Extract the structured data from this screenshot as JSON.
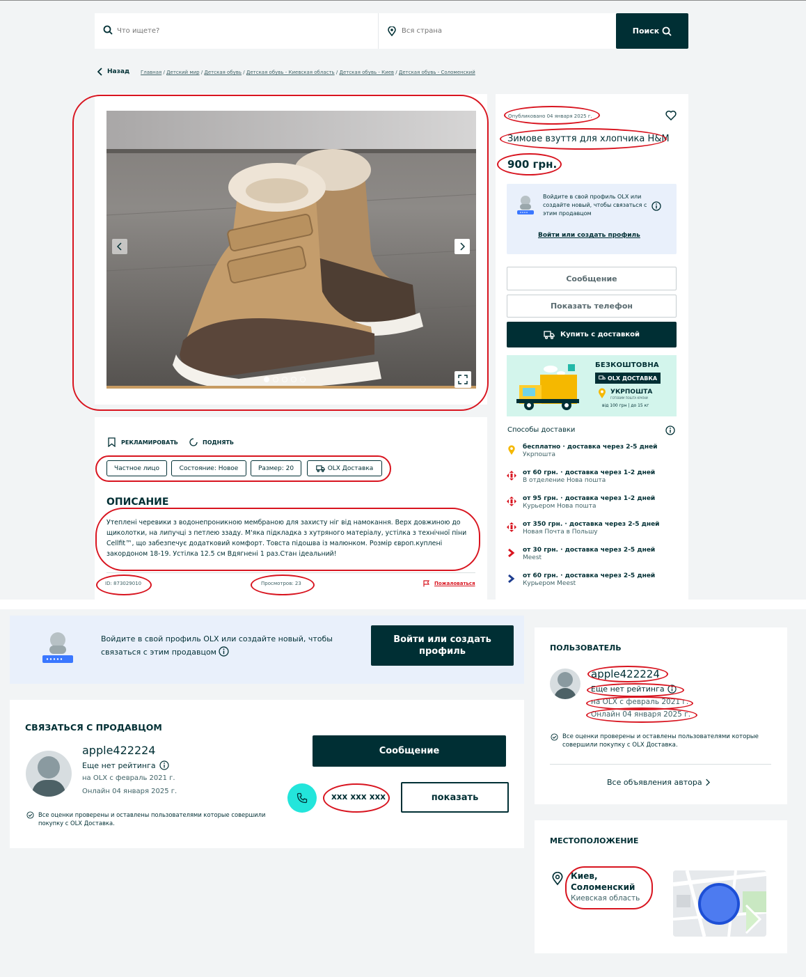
{
  "search": {
    "query_placeholder": "Что ищете?",
    "location_placeholder": "Вся страна",
    "button_label": "Поиск"
  },
  "nav": {
    "back_label": "Назад",
    "breadcrumbs": [
      "Главная",
      "Детский мир",
      "Детская обувь",
      "Детская обувь - Киевская область",
      "Детская обувь - Киев",
      "Детская обувь - Соломенский"
    ]
  },
  "gallery": {
    "slide_count": 5,
    "active_slide": 1
  },
  "listing": {
    "published": "Опубликовано 04 января 2025 г.",
    "title": "Зимове взуття для хлопчика H&M",
    "price": "900 грн."
  },
  "login_box_small": {
    "text": "Войдите в свой профиль OLX или создайте новый, чтобы связаться с этим продавцом",
    "link": "Войти или создать профиль"
  },
  "actions": {
    "message": "Сообщение",
    "show_phone": "Показать телефон",
    "buy": "Купить с доставкой"
  },
  "promo": {
    "headline": "БЕЗКОШТОВНА",
    "olx_delivery": "OLX ДОСТАВКА",
    "carrier": "УКРПОШТА",
    "carrier_sub": "ГОТОВИМ ПОШТА КРАЇНИ",
    "terms": "від 100 грн | до 15 кг"
  },
  "delivery": {
    "title": "Способы доставки",
    "options": [
      {
        "main": "бесплатно · доставка через 2-5 дней",
        "sub": "Укрпошта",
        "icon": "ukrposhta-pin-icon",
        "color": "#f5b800"
      },
      {
        "main": "от 60 грн. · доставка через 1-2 дней",
        "sub": "В отделение Нова пошта",
        "icon": "nova-poshta-icon",
        "color": "#d8141f"
      },
      {
        "main": "от 95 грн. · доставка через 1-2 дней",
        "sub": "Курьером Нова пошта",
        "icon": "nova-poshta-icon",
        "color": "#d8141f"
      },
      {
        "main": "от 350 грн. · доставка через 2-5 дней",
        "sub": "Новая Почта в Польшу",
        "icon": "nova-poshta-icon",
        "color": "#d8141f"
      },
      {
        "main": "от 30 грн. · доставка через 2-5 дней",
        "sub": "Meest",
        "icon": "meest-icon",
        "color": "#d8141f"
      },
      {
        "main": "от 60 грн. · доставка через 2-5 дней",
        "sub": "Курьером Meest",
        "icon": "meest-icon",
        "color": "#1e3d8f"
      }
    ]
  },
  "ad_tools": {
    "promote": "РЕКЛАМИРОВАТЬ",
    "raise": "ПОДНЯТЬ"
  },
  "tags": [
    "Частное лицо",
    "Состояние: Новое",
    "Размер: 20",
    "OLX Доставка"
  ],
  "description": {
    "heading": "ОПИСАНИЕ",
    "text": "Утеплені черевики з водонепроникною мембраною для захисту ніг від намокання. Верх довжиною до щиколотки, на липучці з петлею ззаду. М'яка підкладка з хутряного матеріалу, устілка з технічної піни Cellfit™, що забезпечує додатковий комфорт. Товста підошва із малюнком. Розмір європ.куплені закордоном 18-19. Устілка 12.5 см Вдягнені 1 раз.Стан ідеальний!"
  },
  "footer": {
    "id": "ID: 873029010",
    "views": "Просмотров: 23",
    "report": "Пожаловаться"
  },
  "login_banner": {
    "text": "Войдите в свой профиль OLX или создайте новый, чтобы связаться с этим продавцом",
    "button": "Войти или создать профиль"
  },
  "seller": {
    "heading": "СВЯЗАТЬСЯ С ПРОДАВЦОМ",
    "name": "apple422224",
    "rating": "Еще нет рейтинга",
    "since": "на OLX с февраль 2021 г.",
    "online": "Онлайн 04 января 2025 г.",
    "verified": "Все оценки проверены и оставлены пользователями которые совершили покупку с OLX Доставка.",
    "message_btn": "Сообщение",
    "phone_masked": "xxx xxx xxx",
    "show_btn": "показать"
  },
  "user": {
    "heading": "ПОЛЬЗОВАТЕЛЬ",
    "name": "apple422224",
    "rating": "Еще нет рейтинга",
    "since": "на OLX с февраль 2021 г.",
    "online": "Онлайн 04 января 2025 г.",
    "verified": "Все оценки проверены и оставлены пользователями которые совершили покупку с OLX Доставка.",
    "all_ads": "Все объявления автора"
  },
  "location": {
    "heading": "МЕСТОПОЛОЖЕНИЕ",
    "city": "Киев,",
    "district": "Соломенский",
    "region": "Киевская область"
  }
}
